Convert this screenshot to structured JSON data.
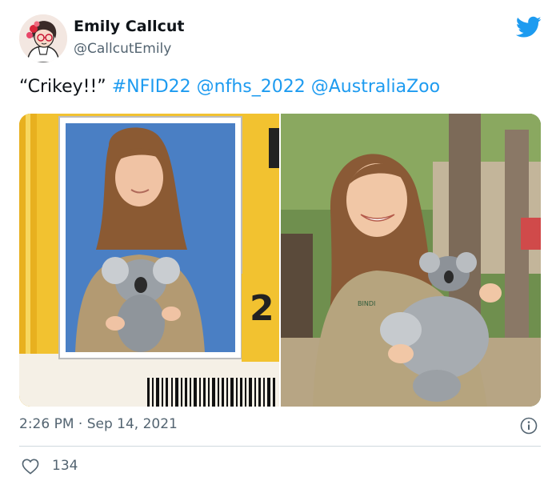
{
  "author": {
    "display_name": "Emily Callcut",
    "handle": "@CallcutEmily",
    "avatar_icon": "cartoon-avatar-icon"
  },
  "platform_icon": "twitter-bird-icon",
  "tweet": {
    "quote": "“Crikey!!”",
    "hashtag": "#NFID22",
    "mention_1": "@nfhs_2022",
    "mention_2": "@AustraliaZoo"
  },
  "media": {
    "left_badge_number": "2",
    "right_shirt_text": "BINDI"
  },
  "meta": {
    "timestamp": "2:26 PM · Sep 14, 2021",
    "likes": "134",
    "info_icon": "info-icon",
    "like_icon": "heart-icon"
  },
  "colors": {
    "link": "#1d9bf0",
    "secondary_text": "#536471",
    "twitter_blue": "#1d9bf0",
    "divider": "#cfd9de"
  }
}
